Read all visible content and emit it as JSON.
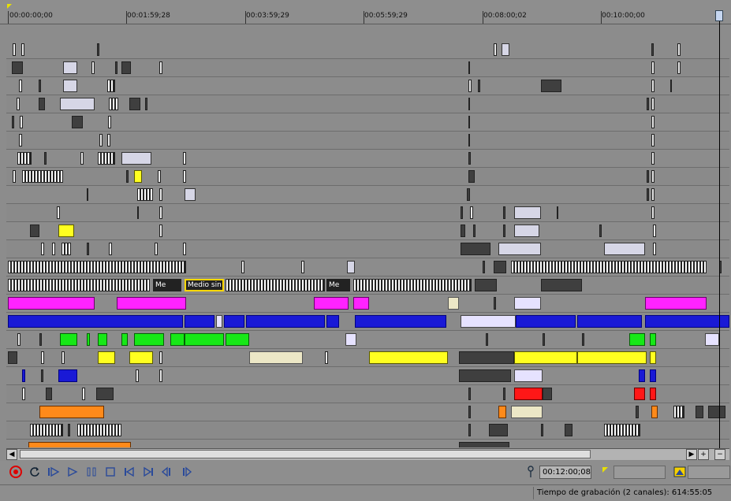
{
  "ruler": {
    "ticks": [
      "00:00:00;00",
      "00:01:59;28",
      "00:03:59;29",
      "00:05:59;29",
      "00:08:00;02",
      "00:10:00;00"
    ],
    "cursor_marker": "!!"
  },
  "media_events": {
    "a": "Me",
    "b": "Medio sin",
    "c": "Me",
    "d": "Me"
  },
  "scroll": {
    "left_arrow": "◀",
    "right_arrow": "▶",
    "zoom_in": "+",
    "zoom_out": "−"
  },
  "transport": {
    "buttons": [
      "record",
      "loop",
      "play-from-start",
      "play",
      "pause",
      "stop",
      "go-to-start",
      "go-to-end",
      "prev-frame",
      "next-frame"
    ],
    "cursor_time": "00:12:00;08"
  },
  "status": {
    "recording_time": "Tiempo de grabación (2 canales): 614:55:05"
  },
  "colors": {
    "timeline_bg": "#8c8c8c",
    "blue": "#1919d6",
    "magenta": "#ff23ff",
    "green": "#17e817",
    "yellow": "#ffff20",
    "red": "#ff1717",
    "orange": "#ff8a1a"
  }
}
